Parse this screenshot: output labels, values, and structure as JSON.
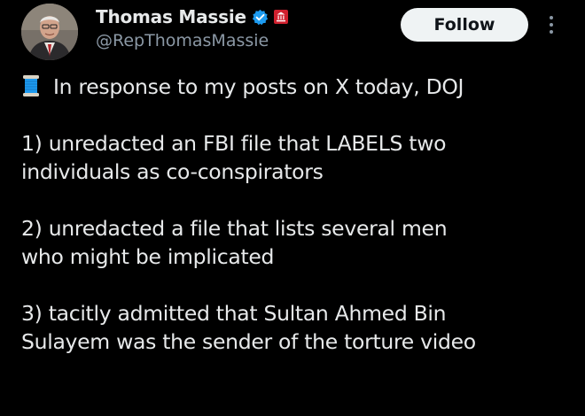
{
  "header": {
    "display_name": "Thomas Massie",
    "handle": "@RepThomasMassie",
    "follow_label": "Follow",
    "badge_color": "#1d9bf0",
    "org_badge_color": "#cf202e"
  },
  "tweet": {
    "intro_emoji": "thread-spool-icon",
    "intro": "In response to my posts on X today, DOJ",
    "item1_line1": "1) unredacted an FBI file that LABELS two",
    "item1_line2": "individuals as co-conspirators",
    "item2_line1": "2) unredacted a file that lists several men",
    "item2_line2": "who might be implicated",
    "item3_line1": "3) tacitly admitted that Sultan Ahmed Bin",
    "item3_line2": "Sulayem was the sender of the torture video"
  },
  "colors": {
    "background": "#000000",
    "text": "#e7e9ea",
    "secondary_text": "#8b98a5",
    "button_bg": "#eff3f4"
  }
}
